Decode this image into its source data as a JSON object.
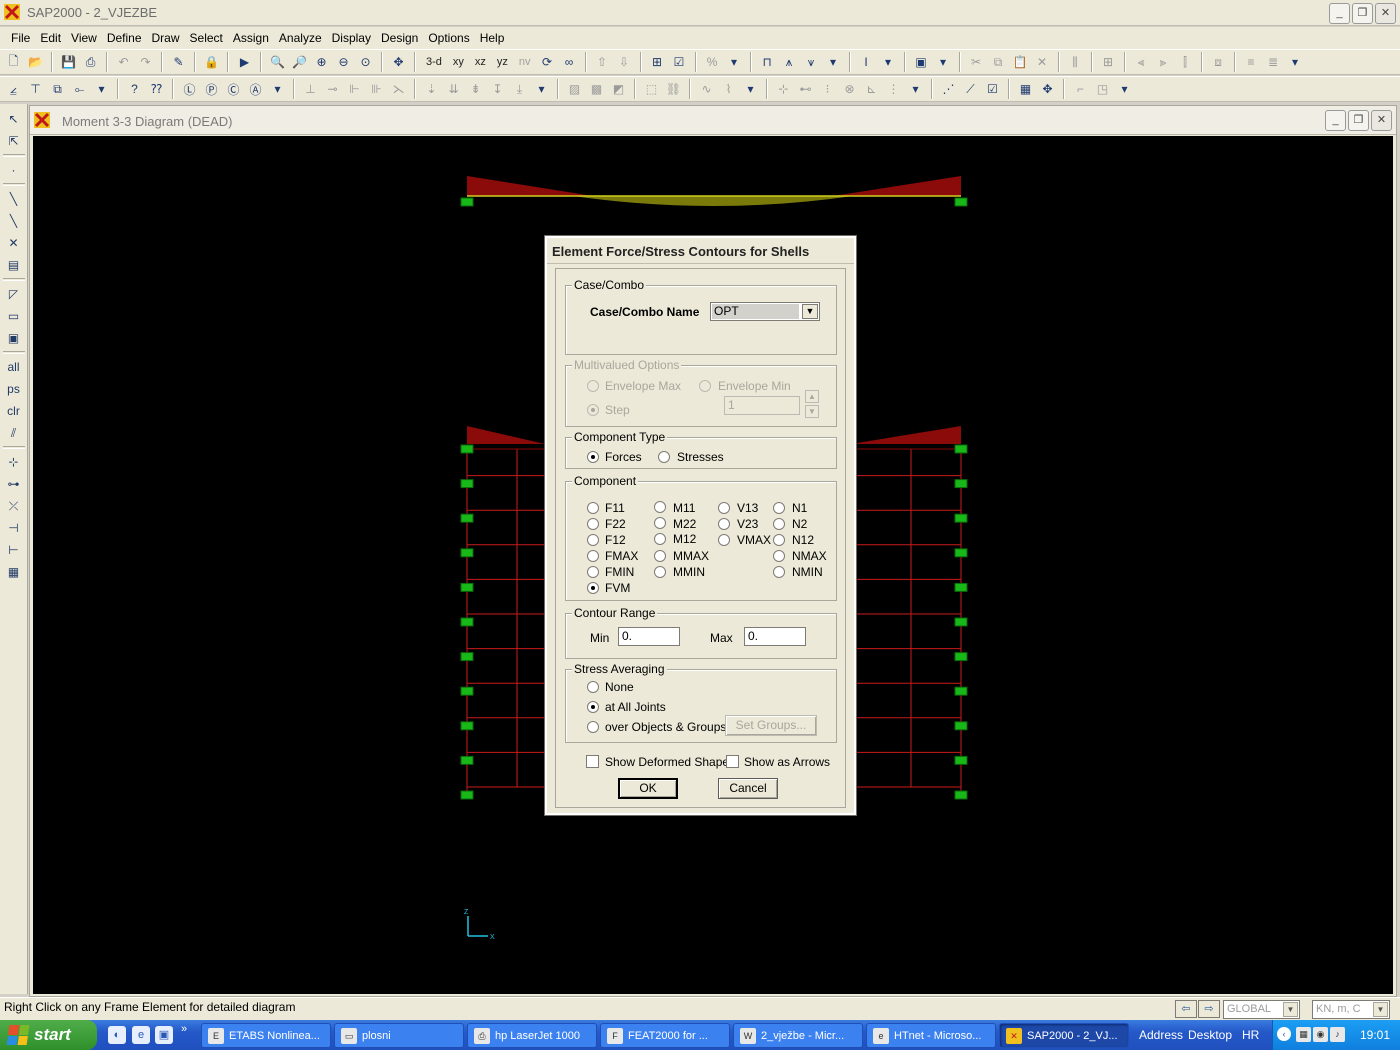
{
  "app": {
    "title": "SAP2000 - 2_VJEZBE",
    "window_controls": [
      "_",
      "❐",
      "✕"
    ]
  },
  "menu": [
    "File",
    "Edit",
    "View",
    "Define",
    "Draw",
    "Select",
    "Assign",
    "Analyze",
    "Display",
    "Design",
    "Options",
    "Help"
  ],
  "toolbar": {
    "view_3d": "3-d",
    "view_xy": "xy",
    "view_xz": "xz",
    "view_yz": "yz",
    "view_nv": "nv"
  },
  "subwindow": {
    "title": "Moment 3-3 Diagram   (DEAD)"
  },
  "canvas": {
    "axis_z": "Z",
    "axis_x": "X",
    "background": "#000000",
    "frame_color": "#cc1a1a",
    "joint_color": "#18b818",
    "moment_color": "#8b0a0a",
    "beam_line": "#d0d020"
  },
  "dialog": {
    "title": "Element Force/Stress Contours for Shells",
    "case_group": "Case/Combo",
    "case_label": "Case/Combo Name",
    "case_value": "OPT",
    "multivalued_group": "Multivalued Options",
    "env_max": "Envelope Max",
    "env_min": "Envelope Min",
    "step": "Step",
    "step_value": "1",
    "component_type_group": "Component Type",
    "forces": "Forces",
    "stresses": "Stresses",
    "component_group": "Component",
    "components": {
      "F11": "F11",
      "F22": "F22",
      "F12": "F12",
      "FMAX": "FMAX",
      "FMIN": "FMIN",
      "FVM": "FVM",
      "M11": "M11",
      "M22": "M22",
      "M12": "M12",
      "MMAX": "MMAX",
      "MMIN": "MMIN",
      "V13": "V13",
      "V23": "V23",
      "VMAX": "VMAX",
      "N1": "N1",
      "N2": "N2",
      "N12": "N12",
      "NMAX": "NMAX",
      "NMIN": "NMIN"
    },
    "selected_component": "FVM",
    "contour_group": "Contour Range",
    "min_label": "Min",
    "min_value": "0.",
    "max_label": "Max",
    "max_value": "0.",
    "averaging_group": "Stress Averaging",
    "avg_none": "None",
    "avg_all_joints": "at All Joints",
    "avg_objects": "over Objects & Groups",
    "set_groups": "Set Groups...",
    "show_deformed": "Show Deformed Shape",
    "show_arrows": "Show as Arrows",
    "ok": "OK",
    "cancel": "Cancel"
  },
  "statusbar": {
    "message": "Right Click on any Frame Element for detailed diagram",
    "coord_system": "GLOBAL",
    "units": "KN, m, C"
  },
  "taskbar": {
    "start": "start",
    "tasks": [
      "ETABS Nonlinea...",
      "plosni",
      "hp LaserJet 1000",
      "FEAT2000 for ...",
      "2_vježbe - Micr...",
      "HTnet - Microso...",
      "SAP2000 - 2_VJ..."
    ],
    "address": "Address",
    "desktop": "Desktop",
    "lang": "HR",
    "clock": "19:01"
  }
}
